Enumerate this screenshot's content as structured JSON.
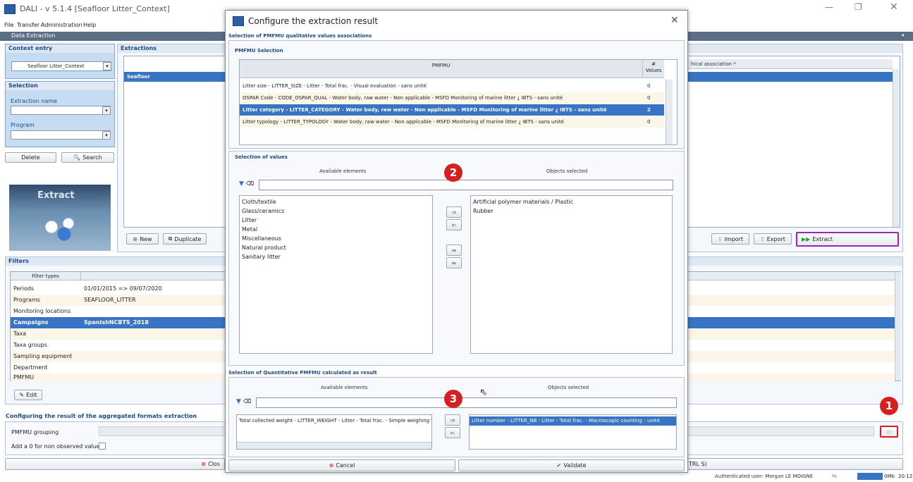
{
  "main": {
    "title": "DALI - v 5.1.4 [Seafloor Litter_Context]",
    "menu": [
      "File",
      "Transfer",
      "Administration",
      "Help"
    ],
    "tab": "Data Extraction",
    "context": {
      "header": "Context entry",
      "value": "Seafloor Litter_Context"
    },
    "selection": {
      "header": "Selection",
      "extraction_label": "Extraction name",
      "program_label": "Program"
    },
    "delete_label": "Delete",
    "search_label": "Search",
    "extract_image_text": "Extract",
    "extractions": {
      "header": "Extractions",
      "row": "Seafloor",
      "right_col": "hical association *"
    },
    "buttons": {
      "new": "New",
      "duplicate": "Duplicate",
      "import": "Import",
      "export": "Export",
      "extract": "Extract"
    },
    "filters": {
      "header": "Filters",
      "col": "Filter types",
      "rows": [
        {
          "type": "Periods",
          "value": "01/01/2015 => 09/07/2020"
        },
        {
          "type": "Programs",
          "value": "SEAFLOOR_LITTER"
        },
        {
          "type": "Monitoring locations",
          "value": ""
        },
        {
          "type": "Campaigns",
          "value": "SpanishNCBTS_2018"
        },
        {
          "type": "Taxa",
          "value": ""
        },
        {
          "type": "Taxa groups",
          "value": ""
        },
        {
          "type": "Sampling equipment",
          "value": ""
        },
        {
          "type": "Department",
          "value": ""
        },
        {
          "type": "PMFMU",
          "value": ""
        }
      ],
      "edit": "Edit"
    },
    "config": {
      "header": "Configuring the result of the aggregated formats extraction",
      "grouping": "PMFMU grouping",
      "add_zero": "Add a 0 for non observed values"
    },
    "close_btn": "Clos",
    "ctrl_s": "TRL S)",
    "status": {
      "user": "Authenticated user: Morgan LE MOIGNE",
      "mem": "0Mb",
      "time": "20:12"
    }
  },
  "dialog": {
    "title": "Configure the extraction result",
    "qual_header": "Selection of PMFMU qualitative values associations",
    "pmfmu_sel": "PMFMU Selection",
    "col_pmfmu": "PMFMU",
    "col_values": "# Values",
    "pmfmu_rows": [
      {
        "label": "Litter size - LITTER_SIZE - Litter - Total frac. - Visual evaluation - sans unité",
        "count": "0"
      },
      {
        "label": "OSPAR Code - CODE_OSPAR_QUAL - Water body, raw water - Non applicable - MSFD Monitoring of marine litter ¿ IBTS - sans unité",
        "count": "0"
      },
      {
        "label": "Litter category - LITTER_CATEGORY - Water body, raw water - Non applicable - MSFD Monitoring of marine litter ¿ IBTS - sans unité",
        "count": "2"
      },
      {
        "label": "Litter typology - LITTER_TYPOLOGY - Water body, raw water - Non applicable - MSFD Monitoring of marine litter ¿ IBTS - sans unité",
        "count": "0"
      }
    ],
    "values_header": "Selection of values",
    "available": "Available elements",
    "selected": "Objects selected",
    "avail_items": [
      "Cloth/textile",
      "Glass/ceramics",
      "Litter",
      "Metal",
      "Miscellaneous",
      "Natural product",
      "Sanitary litter"
    ],
    "sel_items": [
      "Artificial polymer materials / Plastic",
      "Rubber"
    ],
    "quant_header": "Selection of Quantitative PMFMU calculated as result",
    "quant_avail": "Total collected weight - LITTER_WEIGHT - Litter - Total frac. - Simple weighing \\",
    "quant_sel": "Litter number - LITTER_NB - Litter - Total frac. - Macroscopic counting - unité",
    "cancel": "Cancel",
    "validate": "Validate"
  },
  "markers": {
    "one": "1",
    "two": "2",
    "three": "3"
  },
  "colors": {
    "accent": "#3874c4",
    "marker": "#d42020",
    "extract_border": "#a020c0"
  }
}
